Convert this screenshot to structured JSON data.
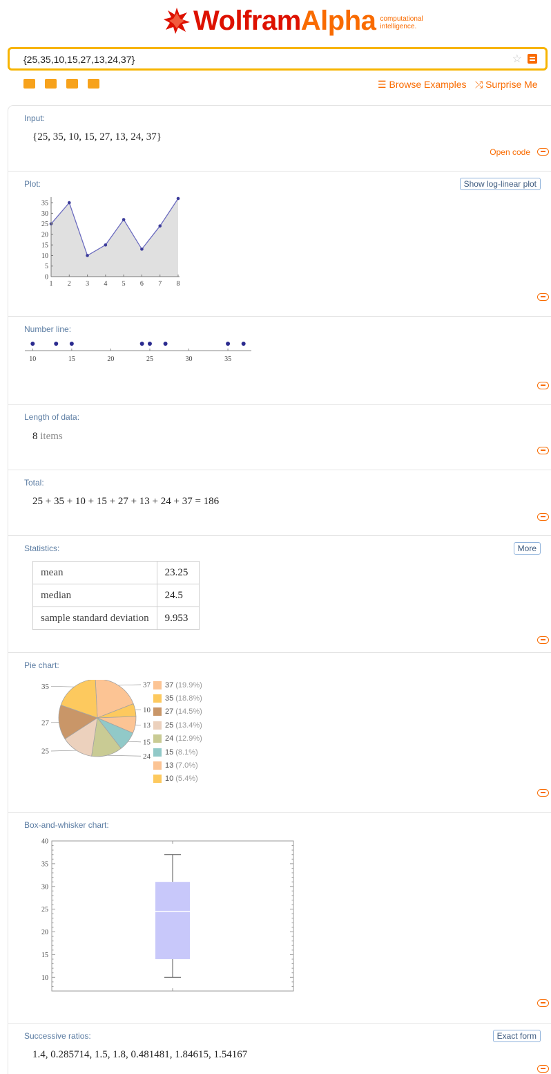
{
  "header": {
    "logo_main": "Wolfram",
    "logo_alpha": "Alpha",
    "logo_tag_line1": "computational",
    "logo_tag_line2": "intelligence."
  },
  "search": {
    "value": "{25,35,10,15,27,13,24,37}"
  },
  "toolbar": {
    "browse_label": "Browse Examples",
    "surprise_label": "Surprise Me",
    "tool_icons": [
      "keyboard-icon",
      "camera-icon",
      "table-icon",
      "extension-icon"
    ]
  },
  "pods": {
    "input": {
      "title": "Input:",
      "text": "{25, 35, 10, 15, 27, 13, 24, 37}",
      "open_code": "Open code"
    },
    "plot": {
      "title": "Plot:",
      "button": "Show log-linear plot"
    },
    "number_line": {
      "title": "Number line:"
    },
    "length": {
      "title": "Length of data:",
      "count": "8",
      "unit": "items"
    },
    "total": {
      "title": "Total:",
      "expression": "25 + 35 + 10 + 15 + 27 + 13 + 24 + 37 = 186"
    },
    "statistics": {
      "title": "Statistics:",
      "button": "More",
      "rows": [
        {
          "label": "mean",
          "value": "23.25"
        },
        {
          "label": "median",
          "value": "24.5"
        },
        {
          "label": "sample standard deviation",
          "value": "9.953"
        }
      ]
    },
    "pie": {
      "title": "Pie chart:"
    },
    "box": {
      "title": "Box-and-whisker chart:"
    },
    "ratios": {
      "title": "Successive ratios:",
      "button": "Exact form",
      "text": "1.4, 0.285714, 1.5, 1.8, 0.481481, 1.84615, 1.54167"
    }
  },
  "chart_data": [
    {
      "type": "line",
      "x": [
        1,
        2,
        3,
        4,
        5,
        6,
        7,
        8
      ],
      "values": [
        25,
        35,
        10,
        15,
        27,
        13,
        24,
        37
      ],
      "x_ticks": [
        "1",
        "2",
        "3",
        "4",
        "5",
        "6",
        "7",
        "8"
      ],
      "y_ticks": [
        "0",
        "5",
        "10",
        "15",
        "20",
        "25",
        "30",
        "35"
      ],
      "ylim": [
        0,
        37
      ],
      "filled": true,
      "color": "#6b6bbf"
    },
    {
      "type": "scatter",
      "values": [
        10,
        13,
        15,
        24,
        25,
        27,
        35,
        37
      ],
      "x_ticks": [
        "10",
        "15",
        "20",
        "25",
        "30",
        "35"
      ],
      "xlim": [
        9,
        38
      ]
    },
    {
      "type": "pie",
      "slices": [
        {
          "value": 37,
          "label": "37",
          "legend": "37",
          "percent": "(19.9%)",
          "color": "#fcc494"
        },
        {
          "value": 35,
          "label": "35",
          "legend": "35",
          "percent": "(18.8%)",
          "color": "#fdc95e"
        },
        {
          "value": 27,
          "label": "27",
          "legend": "27",
          "percent": "(14.5%)",
          "color": "#c99668"
        },
        {
          "value": 25,
          "label": "25",
          "legend": "25",
          "percent": "(13.4%)",
          "color": "#ecd1bd"
        },
        {
          "value": 24,
          "label": "24",
          "legend": "24",
          "percent": "(12.9%)",
          "color": "#c9cb94"
        },
        {
          "value": 15,
          "label": "15",
          "legend": "15",
          "percent": "(8.1%)",
          "color": "#91c9c8"
        },
        {
          "value": 13,
          "label": "13",
          "legend": "13",
          "percent": "(7.0%)",
          "color": "#fcc494"
        },
        {
          "value": 10,
          "label": "10",
          "legend": "10",
          "percent": "(5.4%)",
          "color": "#fdc95e"
        }
      ],
      "data_order": [
        25,
        35,
        10,
        15,
        27,
        13,
        24,
        37
      ]
    },
    {
      "type": "box",
      "min": 10,
      "q1": 14,
      "median": 24.5,
      "q3": 31,
      "max": 37,
      "y_ticks": [
        "10",
        "15",
        "20",
        "25",
        "30",
        "35",
        "40"
      ],
      "ylim": [
        7,
        40
      ],
      "color": "#c8c8fa"
    }
  ]
}
